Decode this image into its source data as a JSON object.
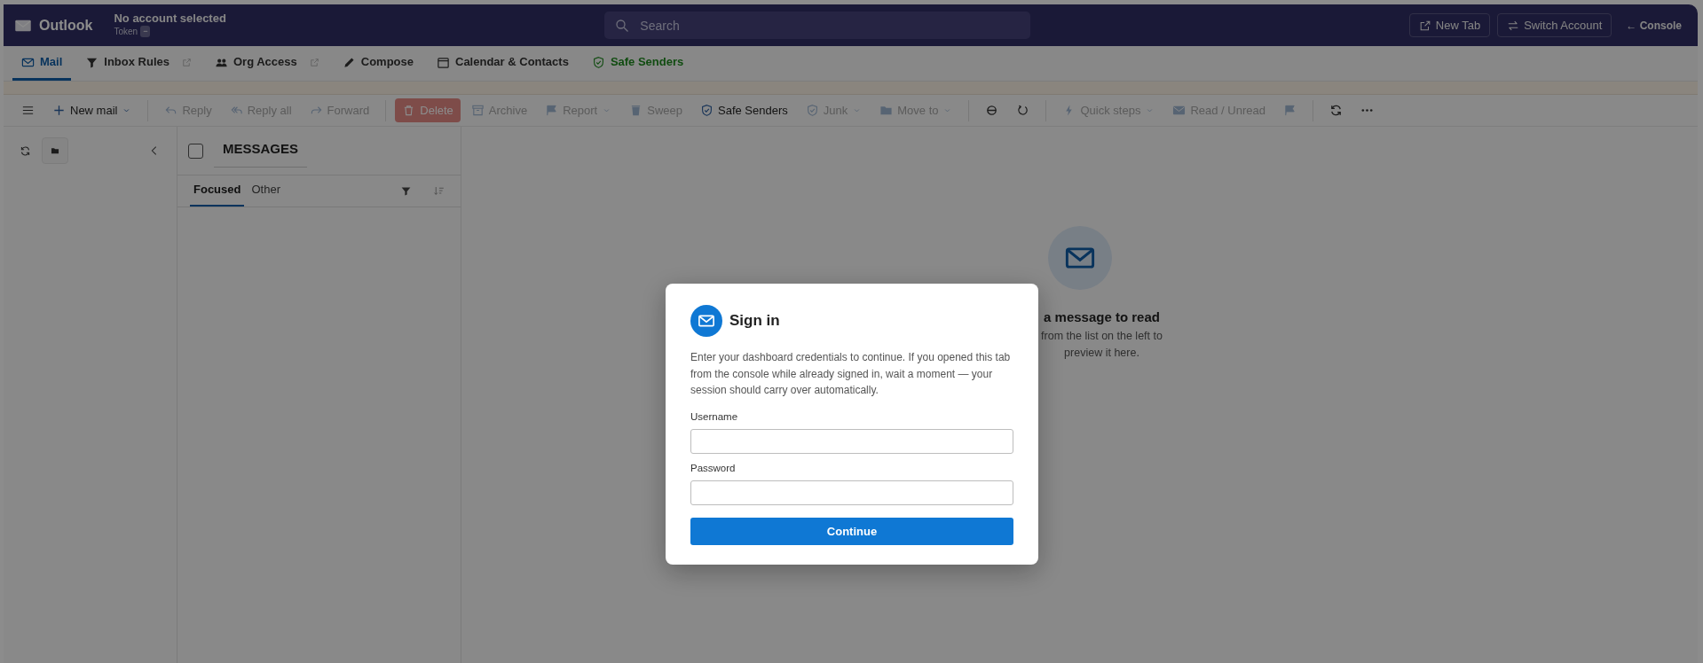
{
  "header": {
    "app_name": "Outlook",
    "account": "No account selected",
    "token_label": "Token",
    "token_badge": "−",
    "search": {
      "placeholder": "Search"
    },
    "buttons": [
      {
        "label": "New Tab"
      },
      {
        "label": "Switch Account"
      }
    ],
    "console_link": "← Console"
  },
  "nav_tabs": [
    {
      "label": "Mail",
      "selected": true,
      "external": false,
      "highlight": false
    },
    {
      "label": "Inbox Rules",
      "selected": false,
      "external": true,
      "highlight": false
    },
    {
      "label": "Org Access",
      "selected": false,
      "external": true,
      "highlight": false
    },
    {
      "label": "Compose",
      "selected": false,
      "external": false,
      "highlight": false
    },
    {
      "label": "Calendar & Contacts",
      "selected": false,
      "external": false,
      "highlight": false
    },
    {
      "label": "Safe Senders",
      "selected": false,
      "external": false,
      "highlight": true
    }
  ],
  "toolbar": [
    {
      "kind": "icon",
      "disabled": false
    },
    {
      "kind": "button",
      "label": "New mail",
      "dropdown": true,
      "disabled": false
    },
    {
      "kind": "separator"
    },
    {
      "kind": "button",
      "label": "Reply",
      "dropdown": false,
      "disabled": true
    },
    {
      "kind": "button",
      "label": "Reply all",
      "dropdown": false,
      "disabled": true
    },
    {
      "kind": "button",
      "label": "Forward",
      "dropdown": false,
      "disabled": true
    },
    {
      "kind": "separator"
    },
    {
      "kind": "danger",
      "label": "Delete",
      "dropdown": false,
      "disabled": true
    },
    {
      "kind": "button",
      "label": "Archive",
      "dropdown": false,
      "disabled": true
    },
    {
      "kind": "button",
      "label": "Report",
      "dropdown": true,
      "disabled": true
    },
    {
      "kind": "button",
      "label": "Sweep",
      "dropdown": false,
      "disabled": true
    },
    {
      "kind": "button",
      "label": "Safe Senders",
      "dropdown": false,
      "disabled": false
    },
    {
      "kind": "button",
      "label": "Junk",
      "dropdown": true,
      "disabled": true
    },
    {
      "kind": "button",
      "label": "Move to",
      "dropdown": true,
      "disabled": true
    },
    {
      "kind": "separator"
    },
    {
      "kind": "icon",
      "disabled": false
    },
    {
      "kind": "icon",
      "disabled": false
    },
    {
      "kind": "separator"
    },
    {
      "kind": "button",
      "label": "Quick steps",
      "dropdown": true,
      "disabled": true
    },
    {
      "kind": "button",
      "label": "Read / Unread",
      "dropdown": false,
      "disabled": true
    },
    {
      "kind": "icon",
      "disabled": true
    },
    {
      "kind": "separator"
    },
    {
      "kind": "icon",
      "disabled": false
    },
    {
      "kind": "icon",
      "disabled": false
    }
  ],
  "message_list": {
    "select_all": {
      "checked": false
    },
    "title": "MESSAGES",
    "tabs": [
      {
        "label": "Focused",
        "selected": true
      },
      {
        "label": "Other",
        "selected": false
      }
    ]
  },
  "reading_pane": {
    "title": "a message to read",
    "lines": [
      "from the list on the left to",
      "preview it here."
    ]
  },
  "sign_in": {
    "title": "Sign in",
    "text": "Enter your dashboard credentials to continue. If you opened this tab from the console while already signed in, wait a moment — your session should carry over automatically.",
    "fields": [
      {
        "label": "Username"
      },
      {
        "label": "Password"
      }
    ],
    "button": "Continue"
  }
}
